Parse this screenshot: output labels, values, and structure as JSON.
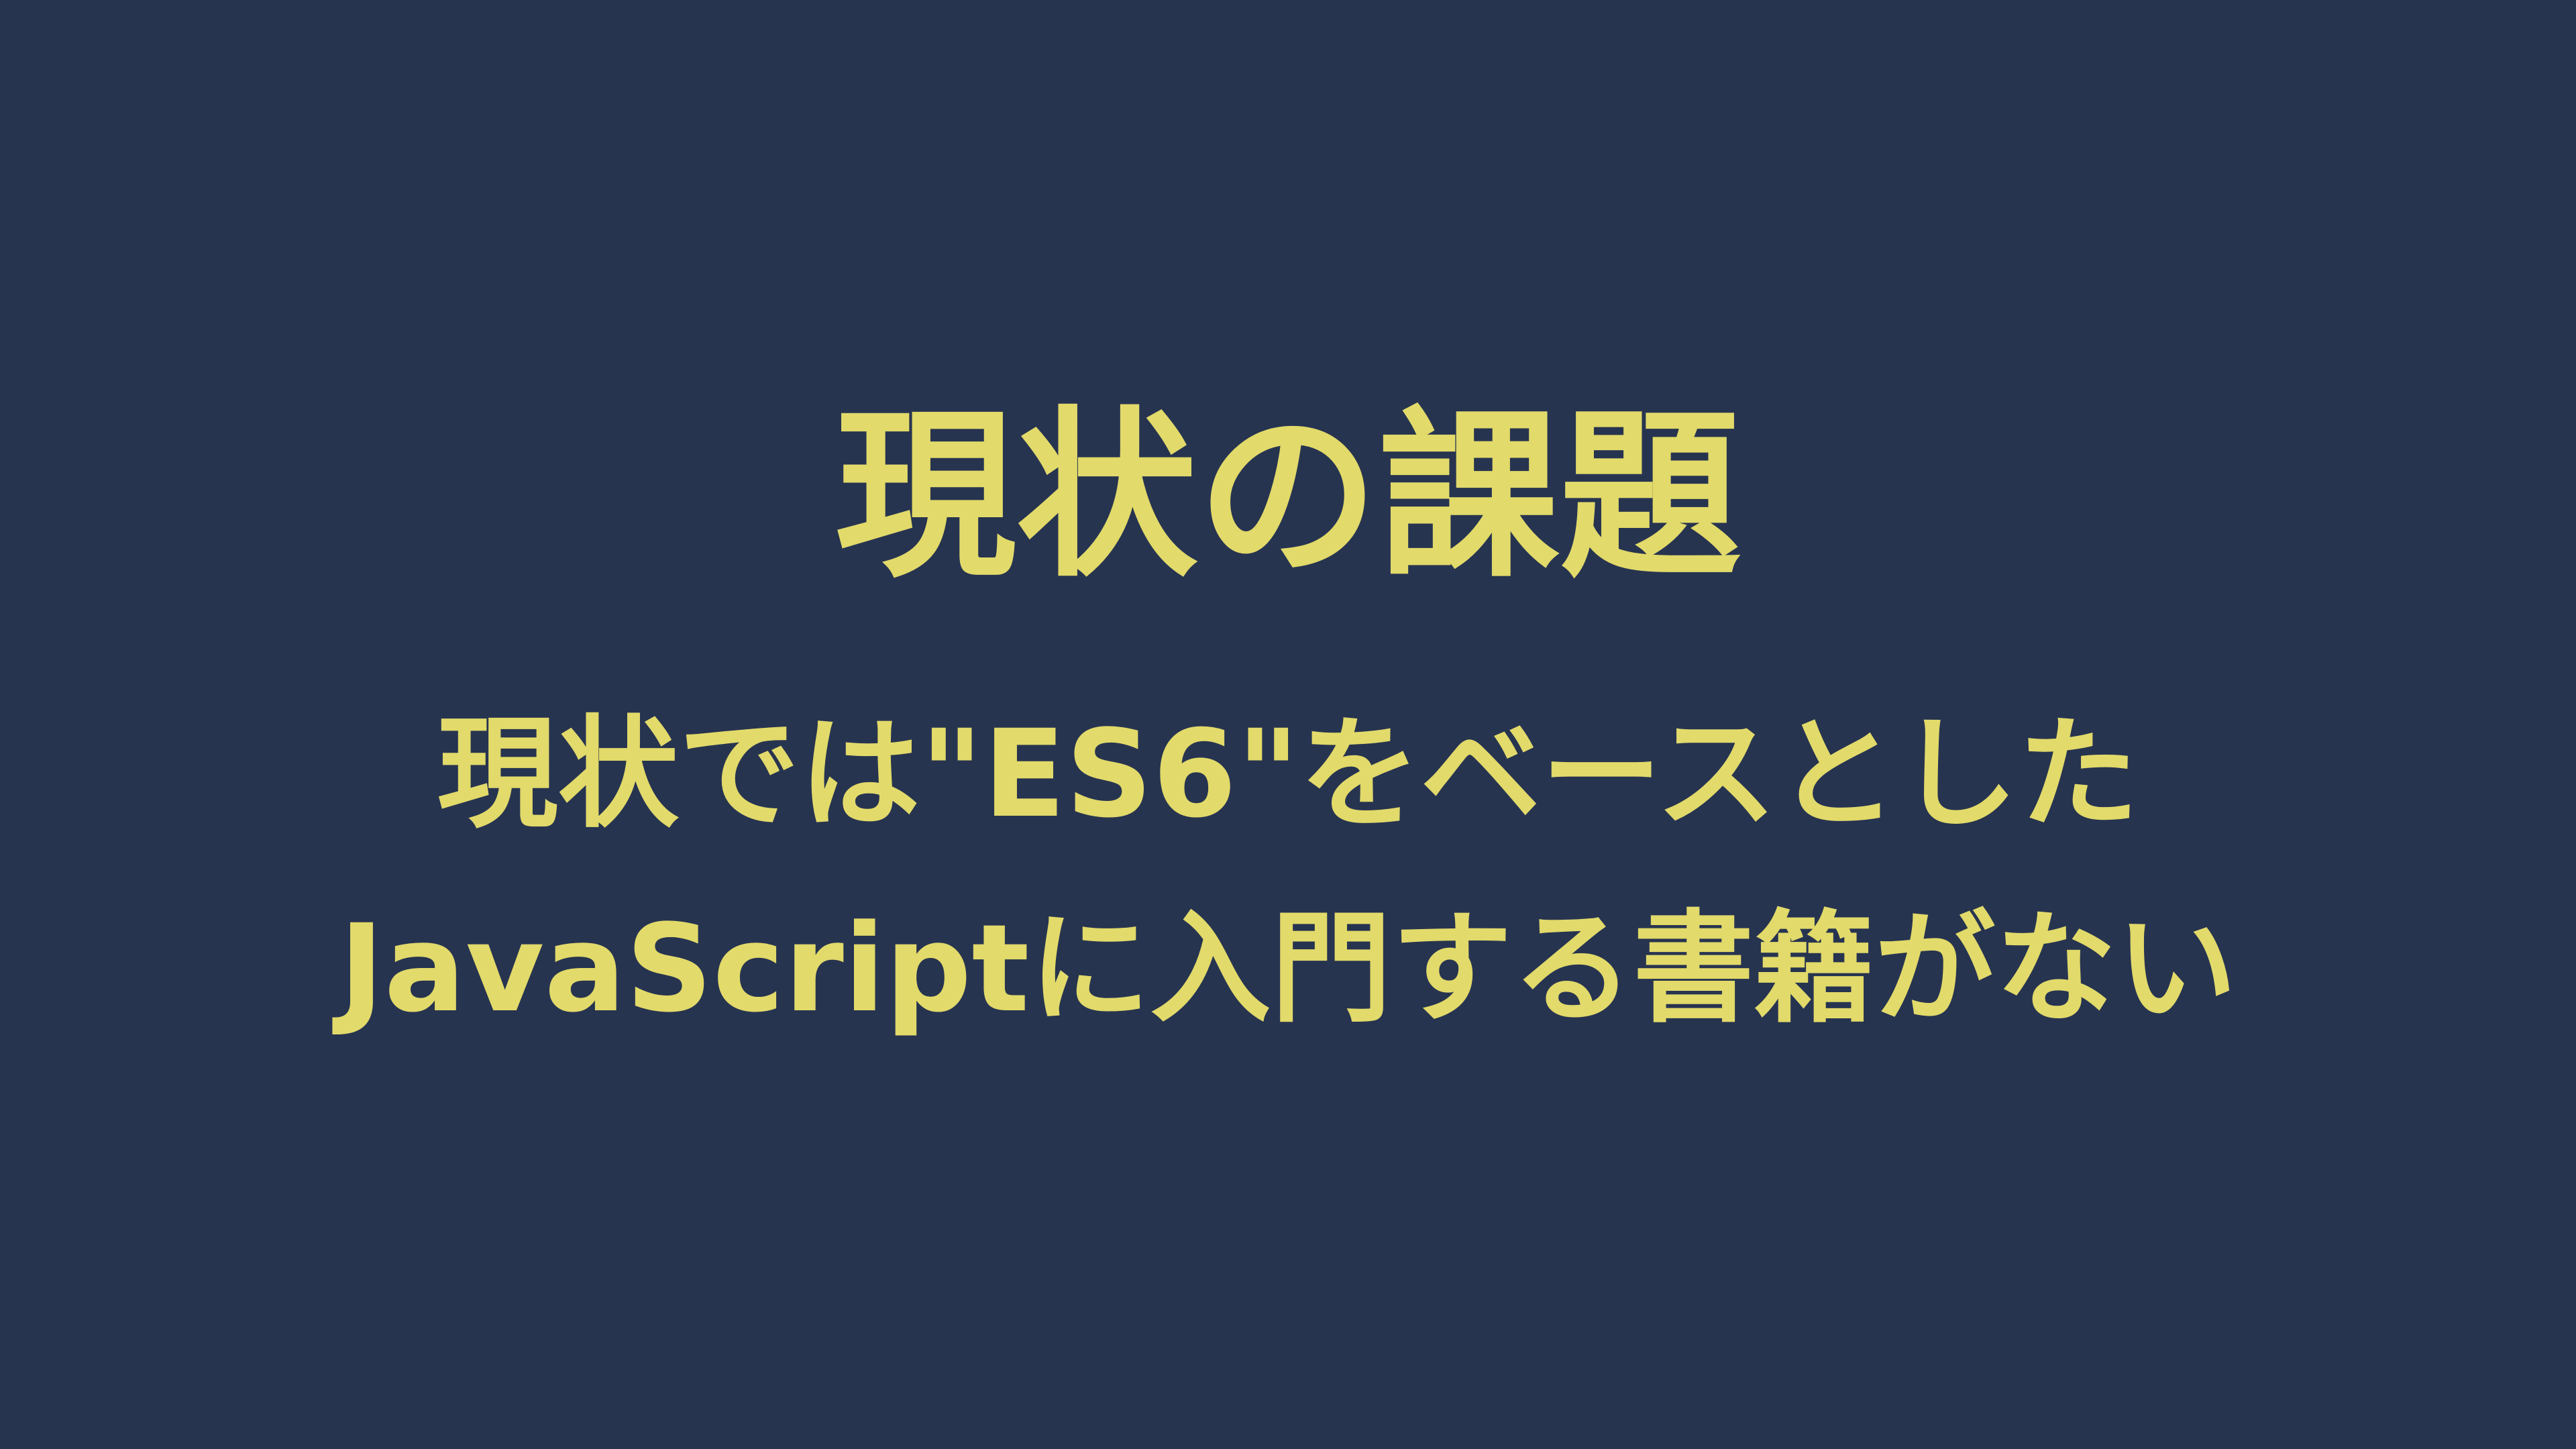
{
  "colors": {
    "background": "#273450",
    "text": "#E2DA6A"
  },
  "slide": {
    "title": "現状の課題",
    "lines": [
      "現状では\"ES6\"をベースとした",
      "JavaScriptに入門する書籍がない"
    ]
  }
}
